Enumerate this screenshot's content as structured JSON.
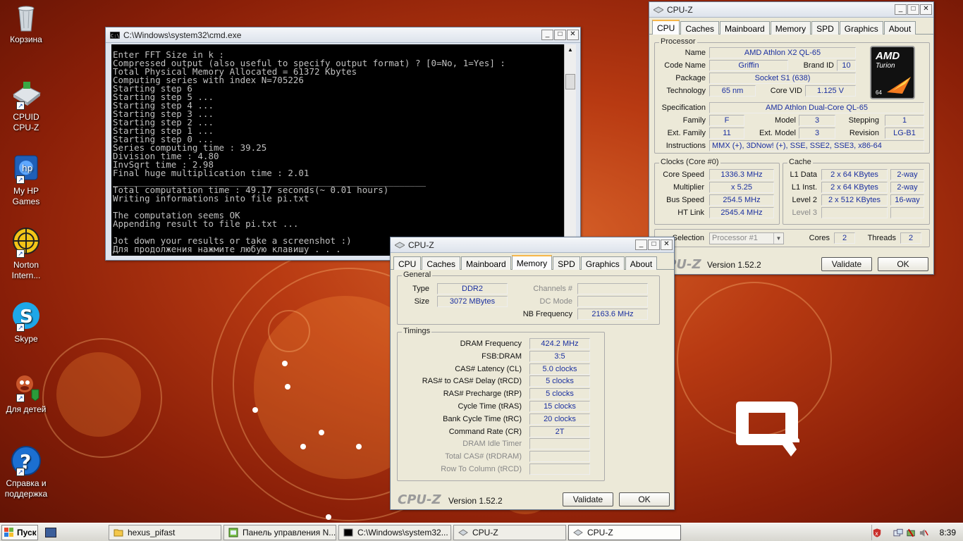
{
  "desktop": {
    "icons": [
      {
        "label": "Корзина",
        "icon": "recycle-bin-icon"
      },
      {
        "label": "CPUID CPU-Z",
        "icon": "cpuz-icon"
      },
      {
        "label": "My HP Games",
        "icon": "hp-games-icon"
      },
      {
        "label": "Norton Intern...",
        "icon": "norton-icon"
      },
      {
        "label": "Skype",
        "icon": "skype-icon"
      },
      {
        "label": "Для детей",
        "icon": "kids-icon"
      },
      {
        "label": "Справка и поддержка",
        "icon": "help-icon"
      }
    ]
  },
  "cmd": {
    "title": "C:\\Windows\\system32\\cmd.exe",
    "lines": [
      "Enter FFT Size in k :",
      "Compressed output (also useful to specify output format) ? [0=No, 1=Yes] :",
      "Total Physical Memory Allocated = 61372 Kbytes",
      "Computing series with index N=705226",
      "Starting step 6",
      "Starting step 5 ...",
      "Starting step 4 ...",
      "Starting step 3 ...",
      "Starting step 2 ...",
      "Starting step 1 ...",
      "Starting step 0 ...",
      "Series computing time : 39.25",
      "Division time : 4.80",
      "InvSqrt time : 2.98",
      "Final huge multiplication time : 2.01",
      "___________________________________________________________",
      "Total computation time : 49.17 seconds(~ 0.01 hours)",
      "Writing informations into file pi.txt",
      "",
      "The computation seems OK",
      "Appending result to file pi.txt ...",
      "",
      "Jot down your results or take a screenshot :)",
      "Для продолжения нажмите любую клавишу . . ."
    ]
  },
  "cpuz_cpu": {
    "title": "CPU-Z",
    "tabs": [
      "CPU",
      "Caches",
      "Mainboard",
      "Memory",
      "SPD",
      "Graphics",
      "About"
    ],
    "active_tab": "CPU",
    "processor_group": "Processor",
    "name_label": "Name",
    "name": "AMD Athlon X2 QL-65",
    "codename_label": "Code Name",
    "codename": "Griffin",
    "brandid_label": "Brand ID",
    "brandid": "10",
    "package_label": "Package",
    "package": "Socket S1 (638)",
    "technology_label": "Technology",
    "technology": "65 nm",
    "corevid_label": "Core VID",
    "corevid": "1.125 V",
    "spec_label": "Specification",
    "spec": "AMD Athlon Dual-Core QL-65",
    "family_label": "Family",
    "family": "F",
    "model_label": "Model",
    "model": "3",
    "stepping_label": "Stepping",
    "stepping": "1",
    "extfamily_label": "Ext. Family",
    "extfamily": "11",
    "extmodel_label": "Ext. Model",
    "extmodel": "3",
    "revision_label": "Revision",
    "revision": "LG-B1",
    "instructions_label": "Instructions",
    "instructions": "MMX (+), 3DNow! (+), SSE, SSE2, SSE3, x86-64",
    "clocks_group": "Clocks (Core #0)",
    "corespeed_label": "Core Speed",
    "corespeed": "1336.3 MHz",
    "multiplier_label": "Multiplier",
    "multiplier": "x 5.25",
    "busspeed_label": "Bus Speed",
    "busspeed": "254.5 MHz",
    "htlink_label": "HT Link",
    "htlink": "2545.4 MHz",
    "cache_group": "Cache",
    "l1data_label": "L1 Data",
    "l1data": "2 x 64 KBytes",
    "l1data_way": "2-way",
    "l1inst_label": "L1 Inst.",
    "l1inst": "2 x 64 KBytes",
    "l1inst_way": "2-way",
    "level2_label": "Level 2",
    "level2": "2 x 512 KBytes",
    "level2_way": "16-way",
    "level3_label": "Level 3",
    "selection_label": "Selection",
    "selection": "Processor #1",
    "cores_label": "Cores",
    "cores": "2",
    "threads_label": "Threads",
    "threads": "2",
    "logo_text": "CPU-Z",
    "version": "Version 1.52.2",
    "validate": "Validate",
    "ok": "OK",
    "amd_logo": {
      "brand": "AMD",
      "sub": "Turion",
      "num": "64"
    }
  },
  "cpuz_mem": {
    "title": "CPU-Z",
    "tabs": [
      "CPU",
      "Caches",
      "Mainboard",
      "Memory",
      "SPD",
      "Graphics",
      "About"
    ],
    "active_tab": "Memory",
    "general_group": "General",
    "type_label": "Type",
    "type": "DDR2",
    "size_label": "Size",
    "size": "3072 MBytes",
    "channels_label": "Channels #",
    "dcmode_label": "DC Mode",
    "nbfreq_label": "NB Frequency",
    "nbfreq": "2163.6 MHz",
    "timings_group": "Timings",
    "timings": [
      {
        "label": "DRAM Frequency",
        "value": "424.2 MHz",
        "dim": false
      },
      {
        "label": "FSB:DRAM",
        "value": "3:5",
        "dim": false
      },
      {
        "label": "CAS# Latency (CL)",
        "value": "5.0 clocks",
        "dim": false
      },
      {
        "label": "RAS# to CAS# Delay (tRCD)",
        "value": "5 clocks",
        "dim": false
      },
      {
        "label": "RAS# Precharge (tRP)",
        "value": "5 clocks",
        "dim": false
      },
      {
        "label": "Cycle Time (tRAS)",
        "value": "15 clocks",
        "dim": false
      },
      {
        "label": "Bank Cycle Time (tRC)",
        "value": "20 clocks",
        "dim": false
      },
      {
        "label": "Command Rate (CR)",
        "value": "2T",
        "dim": false
      },
      {
        "label": "DRAM Idle Timer",
        "value": "",
        "dim": true
      },
      {
        "label": "Total CAS# (tRDRAM)",
        "value": "",
        "dim": true
      },
      {
        "label": "Row To Column (tRCD)",
        "value": "",
        "dim": true
      }
    ],
    "logo_text": "CPU-Z",
    "version": "Version 1.52.2",
    "validate": "Validate",
    "ok": "OK"
  },
  "taskbar": {
    "start": "Пуск",
    "tasks": [
      {
        "label": "hexus_pifast",
        "icon": "folder-icon",
        "active": false
      },
      {
        "label": "Панель управления N...",
        "icon": "control-panel-icon",
        "active": false
      },
      {
        "label": "C:\\Windows\\system32...",
        "icon": "cmd-icon",
        "active": false
      },
      {
        "label": "CPU-Z",
        "icon": "cpuz-icon",
        "active": false
      },
      {
        "label": "CPU-Z",
        "icon": "cpuz-icon",
        "active": true
      }
    ],
    "clock": "8:39"
  }
}
